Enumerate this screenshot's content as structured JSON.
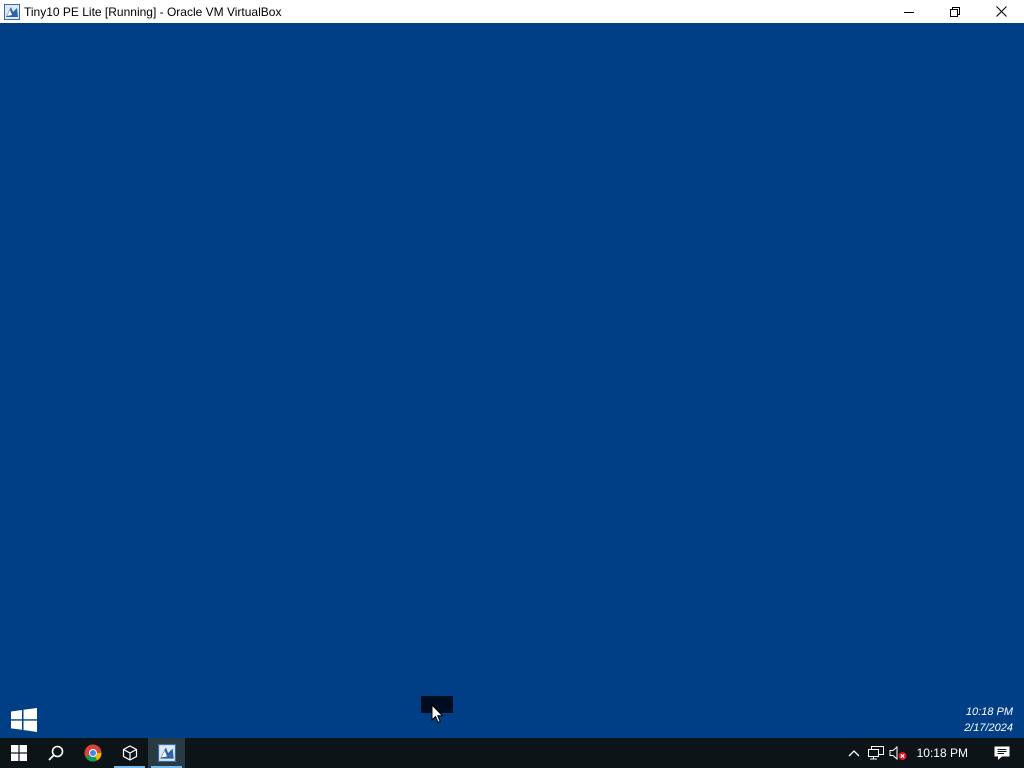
{
  "window": {
    "title": "Tiny10 PE Lite [Running] - Oracle VM VirtualBox",
    "icon": "virtualbox-icon",
    "controls": [
      "minimize-icon",
      "restore-icon",
      "close-icon"
    ]
  },
  "desktop": {
    "background_color": "#003f85",
    "overlay_clock": {
      "time": "10:18 PM",
      "date": "2/17/2024"
    },
    "logo_icon": "windows-logo-icon"
  },
  "taskbar": {
    "buttons": [
      {
        "icon": "start-icon",
        "running": false
      },
      {
        "icon": "search-icon",
        "running": false
      },
      {
        "icon": "chrome-icon",
        "running": false
      },
      {
        "icon": "3d-box-icon",
        "running": true
      },
      {
        "icon": "virtualbox-icon",
        "running": true,
        "active": true
      }
    ],
    "tray": {
      "icons": [
        "chevron-up-icon",
        "network-icon",
        "volume-muted-icon"
      ],
      "time": "10:18 PM",
      "notification_icon": "action-center-icon"
    }
  }
}
